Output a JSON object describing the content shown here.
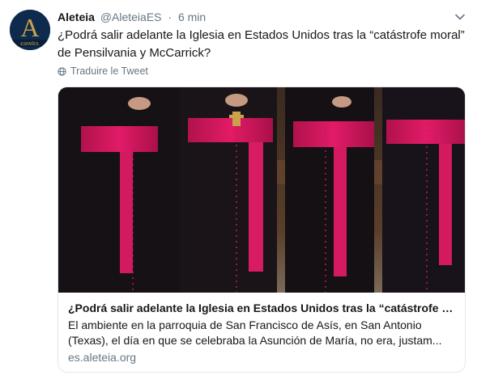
{
  "tweet": {
    "author_name": "Aleteia",
    "author_handle": "@AleteiaES",
    "separator": "·",
    "time": "6 min",
    "text": "¿Podrá salir adelante la Iglesia en Estados Unidos tras la “catástrofe moral” de Pensilvania y McCarrick?",
    "translate_label": "Traduire le Tweet",
    "avatar_letter": "A",
    "avatar_sublabel": "ESPAÑOL"
  },
  "card": {
    "title": "¿Podrá salir adelante la Iglesia en Estados Unidos tras la “catástrofe moral” de Pensilvania y McCarrick?",
    "description": "El ambiente en la parroquia de San Francisco de Asís, en San Antonio (Texas), el día en que se celebraba la Asunción de María, no era, justam...",
    "domain": "es.aleteia.org",
    "image_icon": "clergy-photo"
  },
  "colors": {
    "text_primary": "#14171a",
    "text_secondary": "#657786",
    "border": "#e1e8ed",
    "avatar_bg": "#0e2a4d",
    "avatar_letter": "#c9a24a",
    "sash": "#d6175e"
  }
}
